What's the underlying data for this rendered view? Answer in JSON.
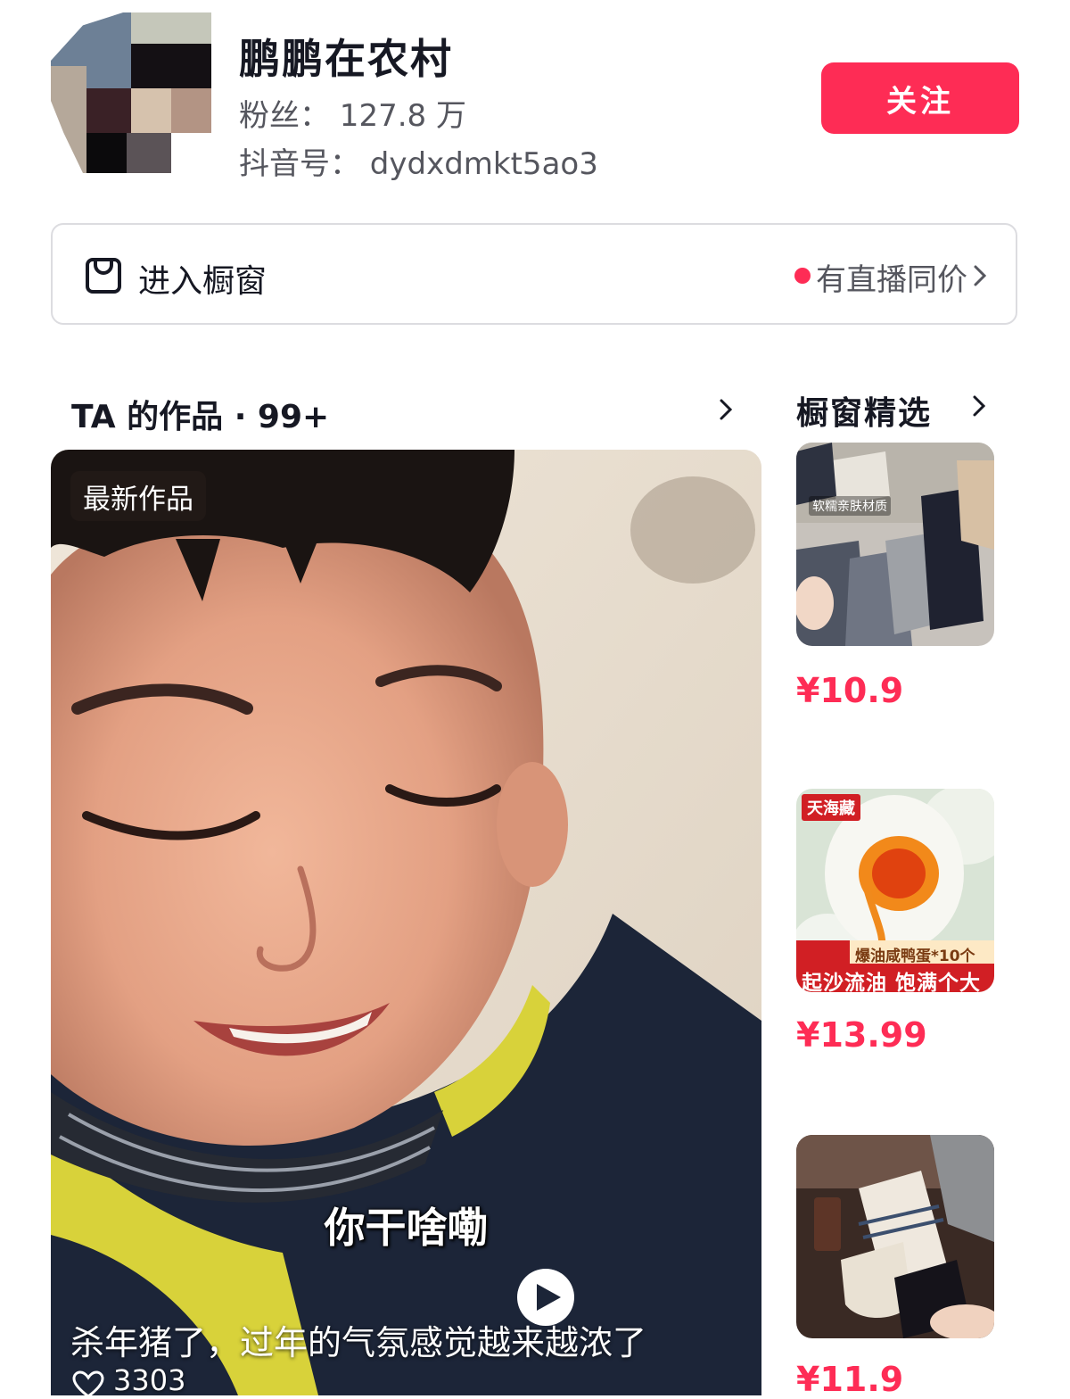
{
  "profile": {
    "name": "鹏鹏在农村",
    "fans": "粉丝： 127.8 万",
    "douyin_id": "抖音号： dydxdmkt5ao3",
    "follow_label": "关注"
  },
  "showcase": {
    "label": "进入橱窗",
    "live_price": "有直播同价"
  },
  "works": {
    "title": "TA 的作品 · 99+",
    "latest_tag": "最新作品",
    "subtitle": "你干啥嘞",
    "description": "杀年猪了，过年的气氛感觉越来越浓了",
    "likes": "3303"
  },
  "picks": {
    "title": "橱窗精选",
    "products": [
      {
        "price": "¥10.9",
        "tag": "软糯亲肤材质"
      },
      {
        "price": "¥13.99",
        "brand": "天海藏",
        "tag_top": "爆油咸鸭蛋*10个",
        "tag_bottom": "起沙流油 饱满个大"
      },
      {
        "price": "¥11.9"
      }
    ]
  },
  "colors": {
    "accent": "#fe2c55",
    "text_primary": "#161823",
    "text_secondary": "#55565e",
    "border": "#dcdce0"
  }
}
